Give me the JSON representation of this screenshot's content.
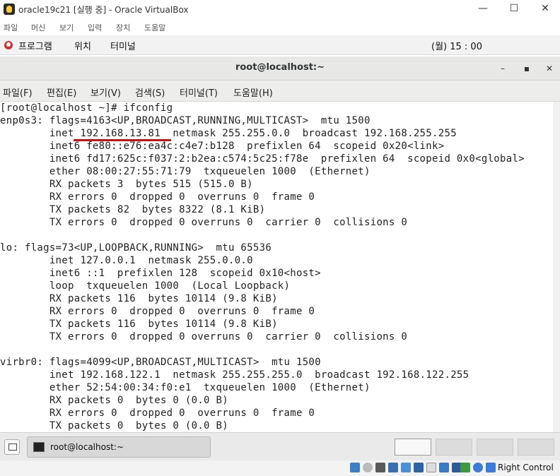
{
  "host_window": {
    "title": "oracle19c21 [실행 중] - Oracle VirtualBox",
    "icon": "virtualbox-icon",
    "controls": {
      "minimize": "—",
      "maximize": "☐",
      "close": "✕"
    }
  },
  "host_menu": [
    "파일",
    "머신",
    "보기",
    "입력",
    "장치",
    "도움말"
  ],
  "gnome_panel": {
    "applications": "프로그램",
    "places": "위치",
    "terminal": "터미널",
    "clock": "(월) 15 : 00",
    "icons": [
      "network-icon",
      "volume-icon",
      "power-icon"
    ]
  },
  "terminal": {
    "title": "root@localhost:~",
    "controls": {
      "minimize": "–",
      "maximize": "▪",
      "close": "✕"
    },
    "menu": [
      "파일(F)",
      "편집(E)",
      "보기(V)",
      "검색(S)",
      "터미널(T)",
      "도움말(H)"
    ],
    "lines": [
      "[root@localhost ~]# ifconfig",
      "enp0s3: flags=4163<UP,BROADCAST,RUNNING,MULTICAST>  mtu 1500",
      "        inet 192.168.13.81  netmask 255.255.0.0  broadcast 192.168.255.255",
      "        inet6 fe80::e76:ea4c:c4e7:b128  prefixlen 64  scopeid 0x20<link>",
      "        inet6 fd17:625c:f037:2:b2ea:c574:5c25:f78e  prefixlen 64  scopeid 0x0<global>",
      "        ether 08:00:27:55:71:79  txqueuelen 1000  (Ethernet)",
      "        RX packets 3  bytes 515 (515.0 B)",
      "        RX errors 0  dropped 0  overruns 0  frame 0",
      "        TX packets 82  bytes 8322 (8.1 KiB)",
      "        TX errors 0  dropped 0 overruns 0  carrier 0  collisions 0",
      "",
      "lo: flags=73<UP,LOOPBACK,RUNNING>  mtu 65536",
      "        inet 127.0.0.1  netmask 255.0.0.0",
      "        inet6 ::1  prefixlen 128  scopeid 0x10<host>",
      "        loop  txqueuelen 1000  (Local Loopback)",
      "        RX packets 116  bytes 10114 (9.8 KiB)",
      "        RX errors 0  dropped 0  overruns 0  frame 0",
      "        TX packets 116  bytes 10114 (9.8 KiB)",
      "        TX errors 0  dropped 0 overruns 0  carrier 0  collisions 0",
      "",
      "virbr0: flags=4099<UP,BROADCAST,MULTICAST>  mtu 1500",
      "        inet 192.168.122.1  netmask 255.255.255.0  broadcast 192.168.122.255",
      "        ether 52:54:00:34:f0:e1  txqueuelen 1000  (Ethernet)",
      "        RX packets 0  bytes 0 (0.0 B)",
      "        RX errors 0  dropped 0  overruns 0  frame 0",
      "        TX packets 0  bytes 0 (0.0 B)"
    ],
    "annotation_color": "#cc1111"
  },
  "taskbar": {
    "window_item": "root@localhost:~",
    "workspaces": 4
  },
  "vb_status": {
    "icons": [
      "hdd-icon",
      "optical-icon",
      "audio-icon",
      "network-icon",
      "usb-icon",
      "shared-folder-icon",
      "display-icon",
      "video-capture-icon",
      "virtualization-icon",
      "mouse-integration-icon",
      "keyboard-icon"
    ],
    "host_key": "Right Control"
  }
}
